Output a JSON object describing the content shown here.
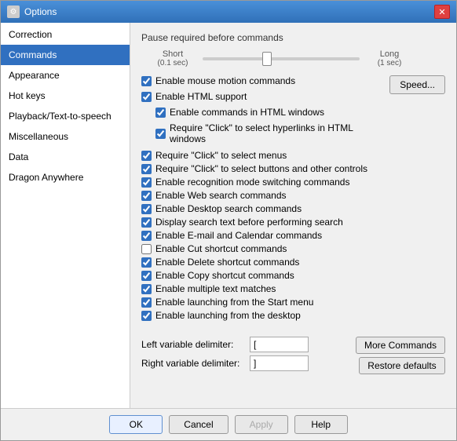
{
  "window": {
    "title": "Options",
    "close_label": "✕"
  },
  "sidebar": {
    "items": [
      {
        "id": "correction",
        "label": "Correction",
        "active": false
      },
      {
        "id": "commands",
        "label": "Commands",
        "active": true
      },
      {
        "id": "appearance",
        "label": "Appearance",
        "active": false
      },
      {
        "id": "hot-keys",
        "label": "Hot keys",
        "active": false
      },
      {
        "id": "playback",
        "label": "Playback/Text-to-speech",
        "active": false
      },
      {
        "id": "miscellaneous",
        "label": "Miscellaneous",
        "active": false
      },
      {
        "id": "data",
        "label": "Data",
        "active": false
      },
      {
        "id": "dragon-anywhere",
        "label": "Dragon Anywhere",
        "active": false
      }
    ]
  },
  "panel": {
    "section_title": "Pause required before commands",
    "slider": {
      "short_label": "Short",
      "short_sub": "(0.1 sec)",
      "long_label": "Long",
      "long_sub": "(1 sec)"
    },
    "speed_button": "Speed...",
    "checkboxes": [
      {
        "id": "mouse-motion",
        "label": "Enable mouse motion commands",
        "checked": true,
        "indent": 0
      },
      {
        "id": "html-support",
        "label": "Enable HTML support",
        "checked": true,
        "indent": 0
      },
      {
        "id": "html-commands",
        "label": "Enable commands in HTML windows",
        "checked": true,
        "indent": 1
      },
      {
        "id": "html-hyperlinks",
        "label": "Require \"Click\" to select hyperlinks in HTML windows",
        "checked": true,
        "indent": 1
      },
      {
        "id": "click-menus",
        "label": "Require \"Click\" to select menus",
        "checked": true,
        "indent": 0
      },
      {
        "id": "click-buttons",
        "label": "Require \"Click\" to select buttons and other controls",
        "checked": true,
        "indent": 0
      },
      {
        "id": "recognition-mode",
        "label": "Enable recognition mode switching commands",
        "checked": true,
        "indent": 0
      },
      {
        "id": "web-search",
        "label": "Enable Web search commands",
        "checked": true,
        "indent": 0
      },
      {
        "id": "desktop-search",
        "label": "Enable Desktop search commands",
        "checked": true,
        "indent": 0
      },
      {
        "id": "display-search",
        "label": "Display search text before performing search",
        "checked": true,
        "indent": 0
      },
      {
        "id": "email-calendar",
        "label": "Enable E-mail and Calendar commands",
        "checked": true,
        "indent": 0
      },
      {
        "id": "cut-shortcut",
        "label": "Enable Cut shortcut commands",
        "checked": false,
        "indent": 0
      },
      {
        "id": "delete-shortcut",
        "label": "Enable Delete shortcut commands",
        "checked": true,
        "indent": 0
      },
      {
        "id": "copy-shortcut",
        "label": "Enable Copy shortcut commands",
        "checked": true,
        "indent": 0
      },
      {
        "id": "multiple-text",
        "label": "Enable multiple text matches",
        "checked": true,
        "indent": 0
      },
      {
        "id": "start-menu",
        "label": "Enable launching from the Start menu",
        "checked": true,
        "indent": 0
      },
      {
        "id": "desktop-launch",
        "label": "Enable launching from the desktop",
        "checked": true,
        "indent": 0
      }
    ],
    "delimiter": {
      "left_label": "Left variable delimiter:",
      "left_value": "[",
      "right_label": "Right variable delimiter:",
      "right_value": "]"
    },
    "buttons": {
      "more_commands": "More Commands",
      "restore_defaults": "Restore defaults"
    }
  },
  "footer": {
    "ok": "OK",
    "cancel": "Cancel",
    "apply": "Apply",
    "help": "Help"
  }
}
